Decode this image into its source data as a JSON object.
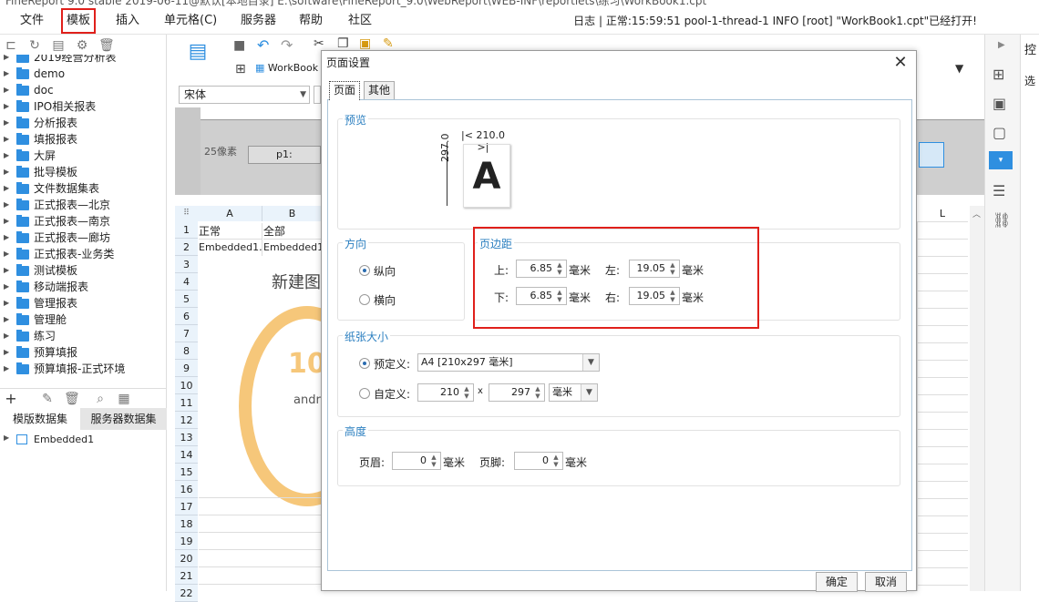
{
  "app": {
    "title": "FineReport 9.0 stable 2019-06-11@默认[本地目录]    E:\\software\\FineReport_9.0\\WebReport\\WEB-INF\\reportlets\\练习\\WorkBook1.cpt"
  },
  "menubar": {
    "items": [
      "文件",
      "模板",
      "插入",
      "单元格(C)",
      "服务器",
      "帮助",
      "社区"
    ],
    "log": "日志 | 正常:15:59:51 pool-1-thread-1 INFO [root] \"WorkBook1.cpt\"已经打开!"
  },
  "tree": {
    "items": [
      "2019经营分析表",
      "demo",
      "doc",
      "IPO相关报表",
      "分析报表",
      "填报报表",
      "大屏",
      "批导模板",
      "文件数据集表",
      "正式报表—北京",
      "正式报表—南京",
      "正式报表—廊坊",
      "正式报表-业务类",
      "测试模板",
      "移动端报表",
      "管理报表",
      "管理舱",
      "练习",
      "预算填报",
      "预算填报-正式环境"
    ]
  },
  "datasets": {
    "tab_template": "模版数据集",
    "tab_server": "服务器数据集",
    "item": "Embedded1"
  },
  "editor": {
    "workbook_tab": "WorkBook",
    "font": "宋体",
    "ruler_label": "25像素",
    "param_label": "p1:",
    "col_a": "A",
    "col_b": "B",
    "col_l": "L",
    "cell_a1": "正常",
    "cell_b1": "全部",
    "cell_a2": "Embedded1.",
    "cell_b2": "Embedded1.",
    "chart_title": "新建图",
    "chart_value": "10",
    "chart_sub": "andro"
  },
  "rightbar": {
    "top_label": "控",
    "second_label": "选"
  },
  "dialog": {
    "title": "页面设置",
    "tab_page": "页面",
    "tab_other": "其他",
    "preview": {
      "title": "预览",
      "width": "210.0",
      "height": "297.0",
      "letter": "A"
    },
    "orientation": {
      "title": "方向",
      "portrait": "纵向",
      "landscape": "横向"
    },
    "margins": {
      "title": "页边距",
      "top_label": "上:",
      "top_value": "6.85",
      "left_label": "左:",
      "left_value": "19.05",
      "bottom_label": "下:",
      "bottom_value": "6.85",
      "right_label": "右:",
      "right_value": "19.05",
      "unit": "毫米"
    },
    "paper": {
      "title": "纸张大小",
      "predefined_label": "预定义:",
      "predefined_value": "A4 [210x297 毫米]",
      "custom_label": "自定义:",
      "custom_w": "210",
      "x": "x",
      "custom_h": "297",
      "unit_value": "毫米"
    },
    "height": {
      "title": "高度",
      "header_label": "页眉:",
      "header_value": "0",
      "footer_label": "页脚:",
      "footer_value": "0",
      "unit": "毫米"
    },
    "ok": "确定",
    "cancel": "取消"
  },
  "colors": {
    "highlight": "#e0201b",
    "accent": "#2b7fc0",
    "folder": "#2f8fe0"
  }
}
